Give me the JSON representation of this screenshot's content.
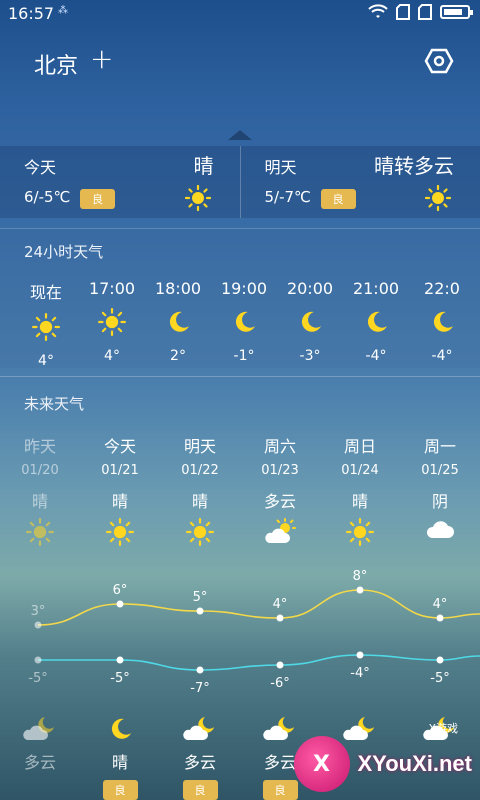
{
  "status_bar": {
    "time": "16:57",
    "sim_glyph": "⁂"
  },
  "header": {
    "city": "北京",
    "add_label": "+"
  },
  "today": {
    "day": "今天",
    "condition": "晴",
    "temp": "6/-5℃",
    "aqi": "良",
    "icon": "sun-icon"
  },
  "tomorrow": {
    "day": "明天",
    "condition": "晴转多云",
    "temp": "5/-7℃",
    "aqi": "良",
    "icon": "sun-icon"
  },
  "hourly": {
    "title": "24小时天气",
    "items": [
      {
        "time": "现在",
        "icon": "sun",
        "temp": "4°"
      },
      {
        "time": "17:00",
        "icon": "sun",
        "temp": "4°"
      },
      {
        "time": "18:00",
        "icon": "moon",
        "temp": "2°"
      },
      {
        "time": "19:00",
        "icon": "moon",
        "temp": "-1°"
      },
      {
        "time": "20:00",
        "icon": "moon",
        "temp": "-3°"
      },
      {
        "time": "21:00",
        "icon": "moon",
        "temp": "-4°"
      },
      {
        "time": "22:0",
        "icon": "moon",
        "temp": "-4°"
      }
    ]
  },
  "future": {
    "title": "未来天气",
    "days": [
      {
        "name": "昨天",
        "date": "01/20",
        "day_cond": "晴",
        "day_icon": "sun",
        "high": 3,
        "high_label": "3°",
        "low": -5,
        "low_label": "-5°",
        "night_icon": "cloud-moon",
        "night_cond": "多云",
        "aqi": "",
        "past": true
      },
      {
        "name": "今天",
        "date": "01/21",
        "day_cond": "晴",
        "day_icon": "sun",
        "high": 6,
        "high_label": "6°",
        "low": -5,
        "low_label": "-5°",
        "night_icon": "moon",
        "night_cond": "晴",
        "aqi": "良",
        "past": false
      },
      {
        "name": "明天",
        "date": "01/22",
        "day_cond": "晴",
        "day_icon": "sun",
        "high": 5,
        "high_label": "5°",
        "low": -7,
        "low_label": "-7°",
        "night_icon": "cloud-moon",
        "night_cond": "多云",
        "aqi": "良",
        "past": false
      },
      {
        "name": "周六",
        "date": "01/23",
        "day_cond": "多云",
        "day_icon": "cloud-sun",
        "high": 4,
        "high_label": "4°",
        "low": -6,
        "low_label": "-6°",
        "night_icon": "cloud-moon",
        "night_cond": "多云",
        "aqi": "良",
        "past": false
      },
      {
        "name": "周日",
        "date": "01/24",
        "day_cond": "晴",
        "day_icon": "sun",
        "high": 8,
        "high_label": "8°",
        "low": -4,
        "low_label": "-4°",
        "night_icon": "cloud-moon",
        "night_cond": "",
        "aqi": "",
        "past": false
      },
      {
        "name": "周一",
        "date": "01/25",
        "day_cond": "阴",
        "day_icon": "cloud",
        "high": 4,
        "high_label": "4°",
        "low": -5,
        "low_label": "-5°",
        "night_icon": "cloud-moon",
        "night_cond": "",
        "aqi": "",
        "past": false
      }
    ]
  },
  "colors": {
    "high_line": "#f3d84a",
    "low_line": "#4fd9e6",
    "badge": "#e5b94f",
    "sun": "#ffd620",
    "moon": "#ffd620"
  },
  "watermark": {
    "text": "XYouXi.net",
    "tag": "X游戏",
    "logo": "X"
  }
}
